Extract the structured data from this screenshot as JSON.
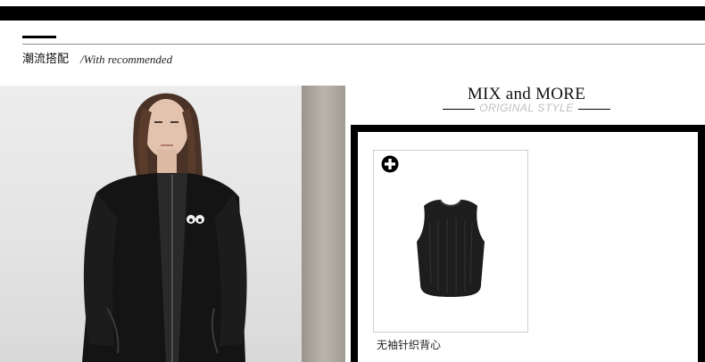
{
  "section": {
    "title": "潮流搭配",
    "subtitle": "/With recommended"
  },
  "feature": {
    "heading": "MIX and MORE",
    "subheading": "ORIGINAL STYLE"
  },
  "products": [
    {
      "name": "无袖针织背心",
      "icon": "plus-circle-icon"
    }
  ],
  "colors": {
    "bar": "#000000",
    "subheading": "#bdbdbd",
    "frame": "#000000"
  }
}
